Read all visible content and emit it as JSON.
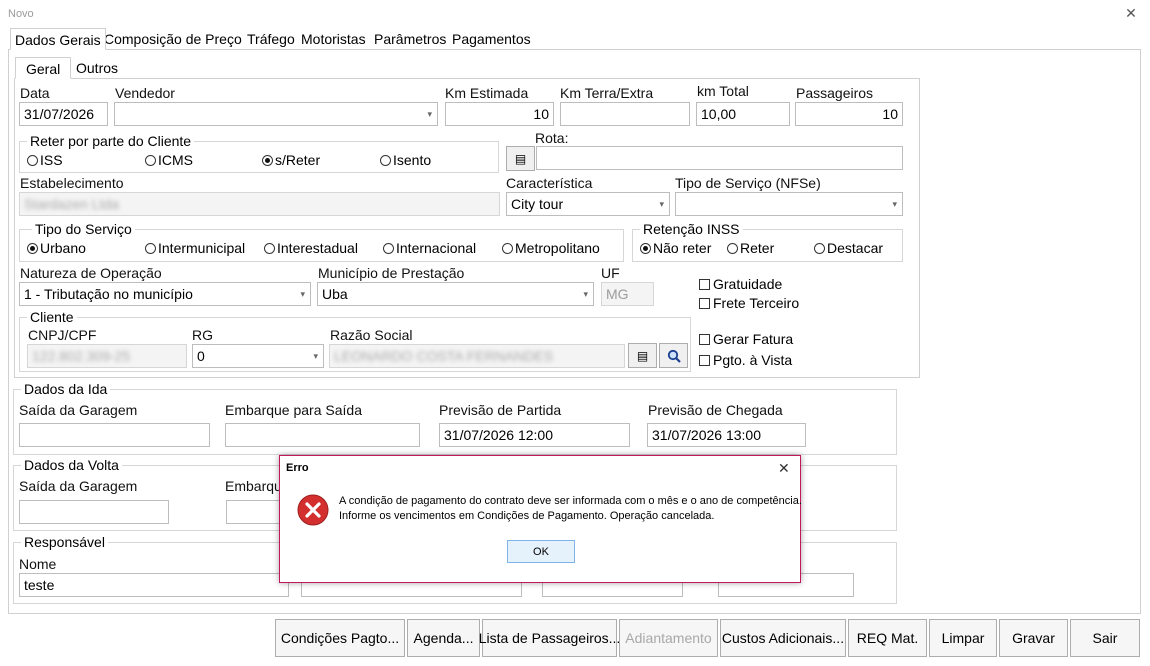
{
  "window": {
    "title": "Novo"
  },
  "main_tabs": [
    "Dados Gerais",
    "Composição de Preço",
    "Tráfego",
    "Motoristas",
    "Parâmetros",
    "Pagamentos"
  ],
  "sub_tabs": [
    "Geral",
    "Outros"
  ],
  "general": {
    "data_label": "Data",
    "data_value": "31/07/2026",
    "vendedor_label": "Vendedor",
    "vendedor_value": "",
    "km_estimada_label": "Km Estimada",
    "km_estimada_value": "10",
    "km_terra_label": "Km Terra/Extra",
    "km_terra_value": "",
    "km_total_label": "km Total",
    "km_total_value": "10,00",
    "passageiros_label": "Passageiros",
    "passageiros_value": "10"
  },
  "reter": {
    "title": "Reter por parte do Cliente",
    "options": [
      "ISS",
      "ICMS",
      "s/Reter",
      "Isento"
    ],
    "selected": "s/Reter"
  },
  "rota": {
    "label": "Rota:",
    "value": ""
  },
  "estabelecimento": {
    "label": "Estabelecimento",
    "value": "Stardazen Ltda"
  },
  "caracteristica": {
    "label": "Característica",
    "value": "City tour"
  },
  "tipo_servico_nfse": {
    "label": "Tipo de Serviço (NFSe)",
    "value": ""
  },
  "tipo_servico": {
    "title": "Tipo do Serviço",
    "options": [
      "Urbano",
      "Intermunicipal",
      "Interestadual",
      "Internacional",
      "Metropolitano"
    ],
    "selected": "Urbano"
  },
  "retencao_inss": {
    "title": "Retenção INSS",
    "options": [
      "Não reter",
      "Reter",
      "Destacar"
    ],
    "selected": "Não reter"
  },
  "natureza": {
    "label": "Natureza de Operação",
    "value": "1 - Tributação no município"
  },
  "municipio": {
    "label": "Município de Prestação",
    "value": "Uba"
  },
  "uf": {
    "label": "UF",
    "value": "MG"
  },
  "checks": [
    "Gratuidade",
    "Frete Terceiro",
    "Gerar Fatura",
    "Pgto. à Vista"
  ],
  "cliente": {
    "title": "Cliente",
    "cnpj_label": "CNPJ/CPF",
    "cnpj_value": "122.802.309-25",
    "rg_label": "RG",
    "rg_value": "0",
    "razao_label": "Razão Social",
    "razao_value": "LEONARDO COSTA FERNANDES"
  },
  "ida": {
    "title": "Dados da Ida",
    "saida_label": "Saída da Garagem",
    "saida_value": "",
    "embarque_label": "Embarque para Saída",
    "embarque_value": "",
    "partida_label": "Previsão de Partida",
    "partida_value": "31/07/2026 12:00",
    "chegada_label": "Previsão de Chegada",
    "chegada_value": "31/07/2026 13:00"
  },
  "volta": {
    "title": "Dados da Volta",
    "saida_label": "Saída da Garagem",
    "saida_value": "",
    "embarque_label": "Embarque"
  },
  "responsavel": {
    "title": "Responsável",
    "nome_label": "Nome",
    "nome_value": "teste"
  },
  "bottom_buttons": [
    "Condições Pagto...",
    "Agenda...",
    "Lista de Passageiros...",
    "Adiantamento",
    "Custos Adicionais...",
    "REQ Mat.",
    "Limpar",
    "Gravar",
    "Sair"
  ],
  "dialog": {
    "title": "Erro",
    "line1": "A condição de pagamento do contrato deve ser informada com o mês e o ano de competência.",
    "line2": "Informe os vencimentos em Condições de Pagamento. Operação cancelada.",
    "ok": "OK",
    "icon": "error-icon"
  },
  "colors": {
    "dialog_border": "#c2185b",
    "error_red": "#d32f2f",
    "ok_bg": "#e5f1fb",
    "ok_border": "#7eb4ea"
  }
}
